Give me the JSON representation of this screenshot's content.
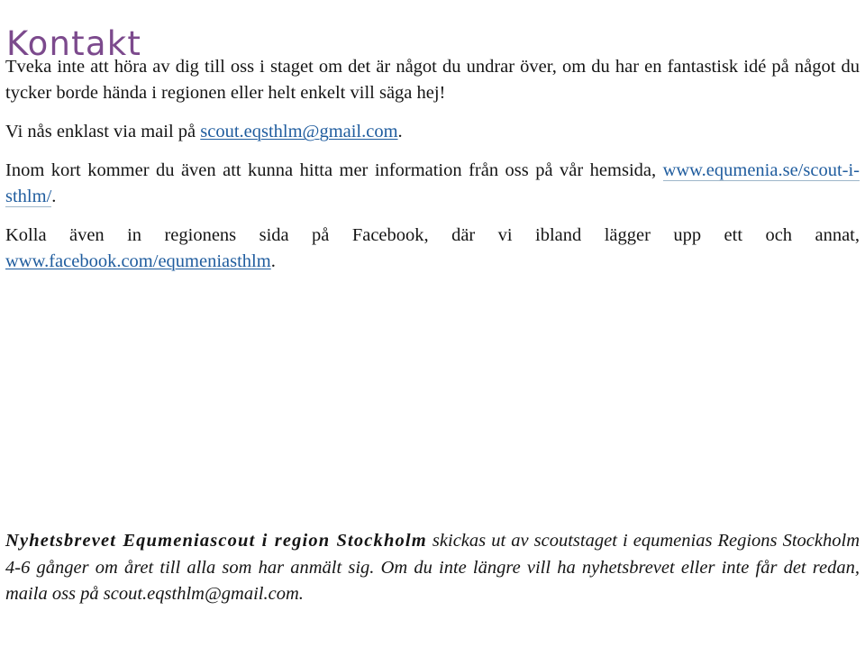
{
  "document": {
    "title": "Kontakt",
    "title_color": "#7c4a8d",
    "link_color": "#1f5c9e",
    "text_color": "#151515",
    "background_color": "#ffffff"
  },
  "paragraphs": {
    "intro": "Tveka inte att höra av dig till oss i staget om det är något du undrar över, om du har en fantastisk idé på något du tycker borde hända i regionen eller helt enkelt vill säga hej!",
    "mail_prefix": "Vi nås enklast via mail på ",
    "mail_link": "scout.eqsthlm@gmail.com",
    "mail_suffix": ".",
    "website_prefix": "Inom kort kommer du även att kunna hitta mer information från oss på vår hemsida, ",
    "website_link": "www.equmenia.se/scout-i-sthlm/",
    "website_suffix": ".",
    "facebook_prefix": "Kolla även in regionens sida på Facebook, där vi ibland lägger upp ett och annat, ",
    "facebook_link": "www.facebook.com/equmeniasthlm",
    "facebook_suffix": "."
  },
  "newsletter": {
    "lead": "Nyhetsbrevet Equmeniascout i region Stockholm",
    "body_prefix": " skickas ut av scoutstaget i equmenias Regions Stockholm 4-6 gånger om året till alla som har anmält sig. Om du inte längre vill ha nyhetsbrevet eller inte får det redan, maila oss på ",
    "mail": "scout.eqsthlm@gmail.com",
    "body_suffix": "."
  }
}
